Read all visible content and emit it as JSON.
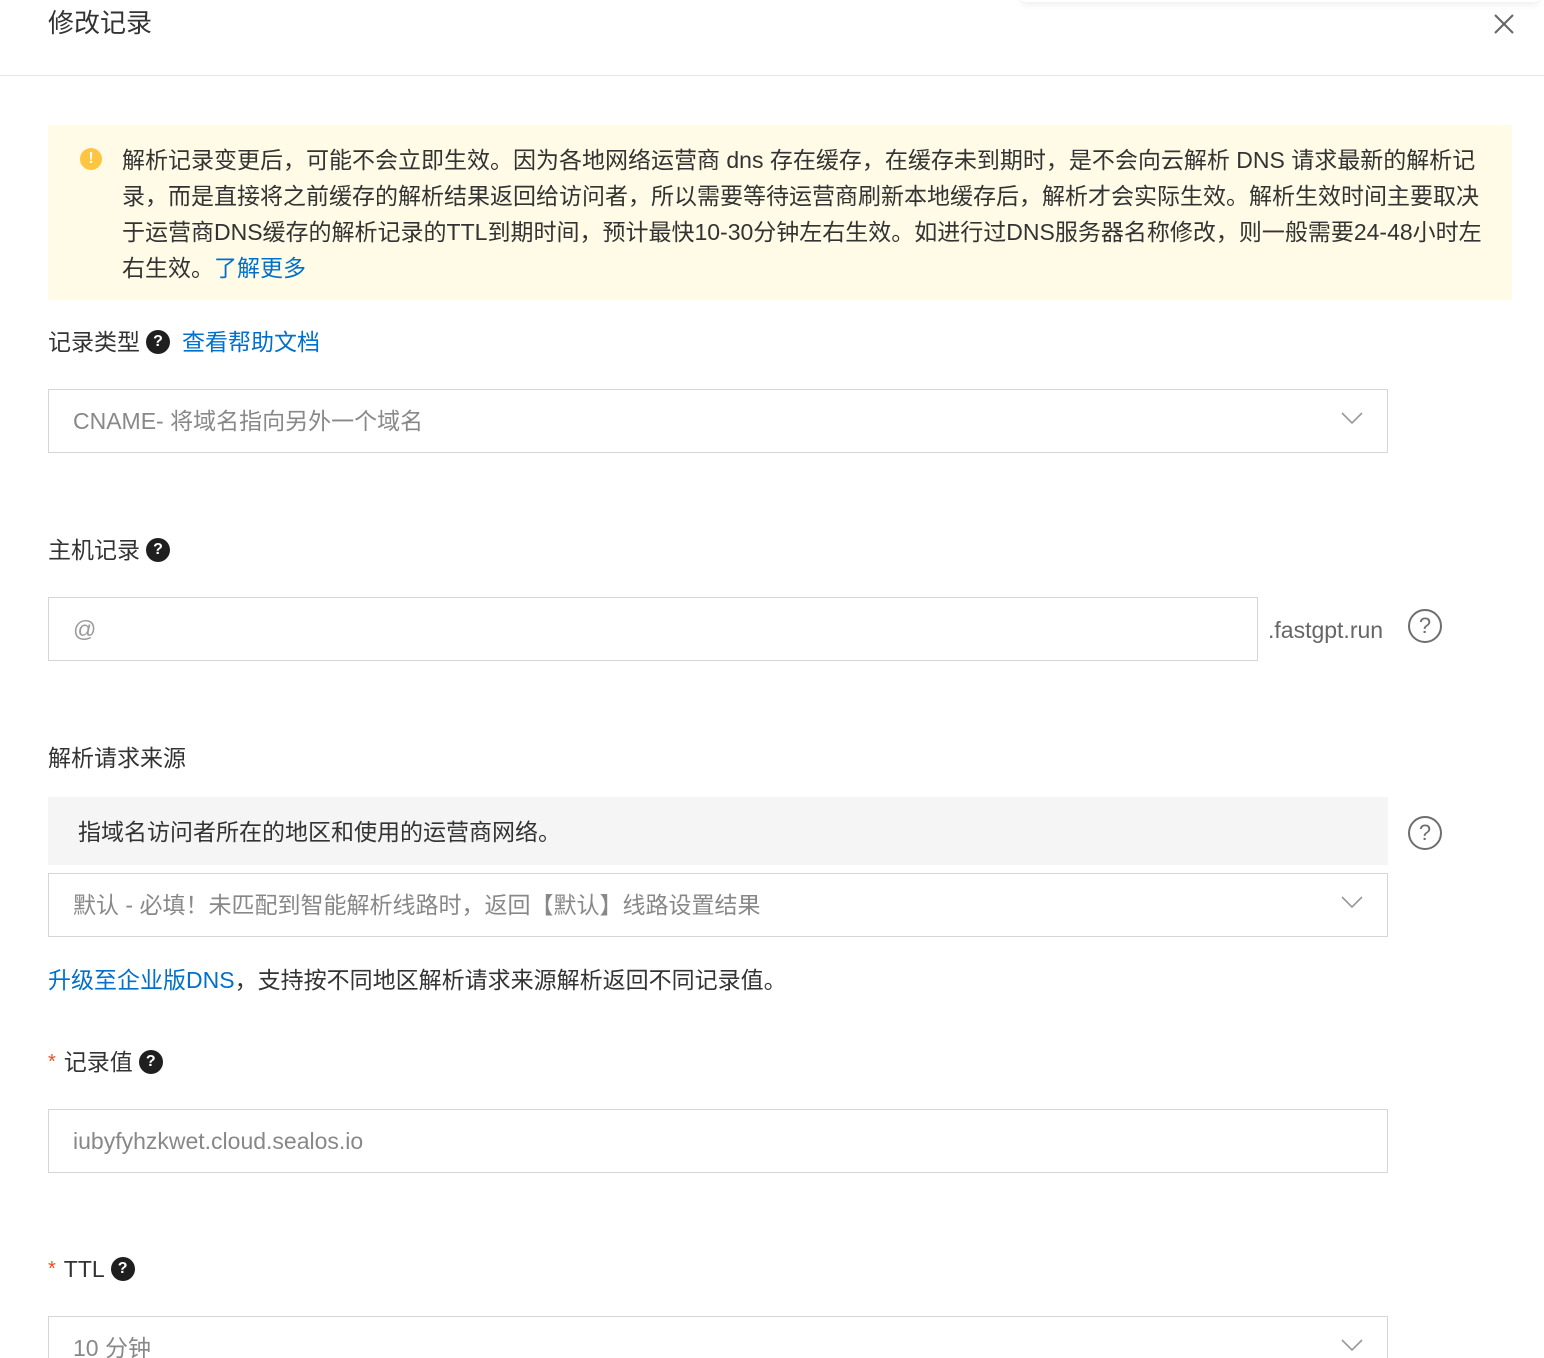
{
  "dialog": {
    "title": "修改记录"
  },
  "alert": {
    "text": "解析记录变更后，可能不会立即生效。因为各地网络运营商 dns 存在缓存，在缓存未到期时，是不会向云解析 DNS 请求最新的解析记录，而是直接将之前缓存的解析结果返回给访问者，所以需要等待运营商刷新本地缓存后，解析才会实际生效。解析生效时间主要取决于运营商DNS缓存的解析记录的TTL到期时间，预计最快10-30分钟左右生效。如进行过DNS服务器名称修改，则一般需要24-48小时左右生效。",
    "link": "了解更多"
  },
  "record_type": {
    "label": "记录类型",
    "help_link": "查看帮助文档",
    "value": "CNAME- 将域名指向另外一个域名"
  },
  "host_record": {
    "label": "主机记录",
    "value": "@",
    "suffix": ".fastgpt.run"
  },
  "request_source": {
    "label": "解析请求来源",
    "info": "指域名访问者所在的地区和使用的运营商网络。",
    "value": "默认 - 必填！未匹配到智能解析线路时，返回【默认】线路设置结果",
    "upgrade_link": "升级至企业版DNS",
    "upgrade_text": "，支持按不同地区解析请求来源解析返回不同记录值。"
  },
  "record_value": {
    "required_mark": "*",
    "label": "记录值",
    "value": "iubyfyhzkwet.cloud.sealos.io"
  },
  "ttl": {
    "required_mark": "*",
    "label": "TTL",
    "value": "10 分钟"
  },
  "icons": {
    "alert": "warning-icon",
    "help": "question-icon",
    "close": "close-icon",
    "dropdown": "chevron-down-icon"
  },
  "colors": {
    "link": "#0070cc",
    "alert_bg": "#fffbe6",
    "alert_icon": "#ffc440",
    "required": "#f04e23"
  }
}
